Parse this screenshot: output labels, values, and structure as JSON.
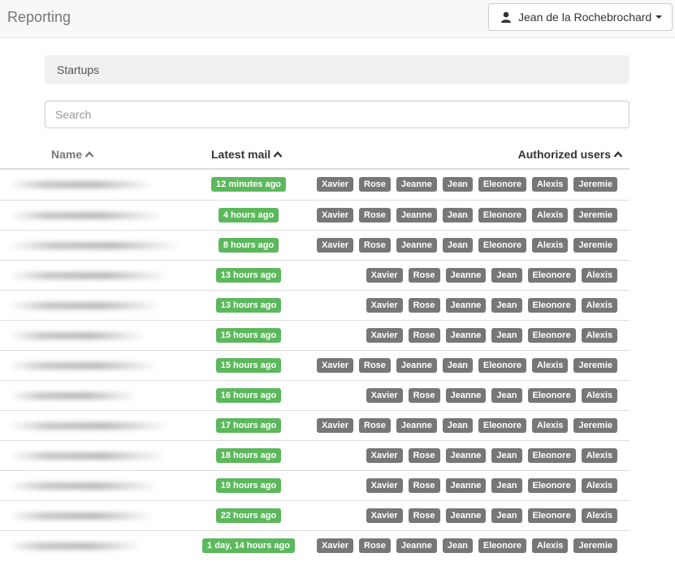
{
  "header": {
    "brand": "Reporting",
    "user_name": "Jean de la Rochebrochard"
  },
  "breadcrumb": {
    "label": "Startups"
  },
  "search": {
    "placeholder": "Search"
  },
  "table": {
    "columns": [
      "Name",
      "Latest mail",
      "Authorized users"
    ],
    "rows": [
      {
        "latest": "12 minutes ago",
        "users": [
          "Xavier",
          "Rose",
          "Jeanne",
          "Jean",
          "Eleonore",
          "Alexis",
          "Jeremie"
        ]
      },
      {
        "latest": "4 hours ago",
        "users": [
          "Xavier",
          "Rose",
          "Jeanne",
          "Jean",
          "Eleonore",
          "Alexis",
          "Jeremie"
        ]
      },
      {
        "latest": "8 hours ago",
        "users": [
          "Xavier",
          "Rose",
          "Jeanne",
          "Jean",
          "Eleonore",
          "Alexis",
          "Jeremie"
        ]
      },
      {
        "latest": "13 hours ago",
        "users": [
          "Xavier",
          "Rose",
          "Jeanne",
          "Jean",
          "Eleonore",
          "Alexis"
        ]
      },
      {
        "latest": "13 hours ago",
        "users": [
          "Xavier",
          "Rose",
          "Jeanne",
          "Jean",
          "Eleonore",
          "Alexis"
        ]
      },
      {
        "latest": "15 hours ago",
        "users": [
          "Xavier",
          "Rose",
          "Jeanne",
          "Jean",
          "Eleonore",
          "Alexis"
        ]
      },
      {
        "latest": "15 hours ago",
        "users": [
          "Xavier",
          "Rose",
          "Jeanne",
          "Jean",
          "Eleonore",
          "Alexis",
          "Jeremie"
        ]
      },
      {
        "latest": "16 hours ago",
        "users": [
          "Xavier",
          "Rose",
          "Jeanne",
          "Jean",
          "Eleonore",
          "Alexis"
        ]
      },
      {
        "latest": "17 hours ago",
        "users": [
          "Xavier",
          "Rose",
          "Jeanne",
          "Jean",
          "Eleonore",
          "Alexis",
          "Jeremie"
        ]
      },
      {
        "latest": "18 hours ago",
        "users": [
          "Xavier",
          "Rose",
          "Jeanne",
          "Jean",
          "Eleonore",
          "Alexis"
        ]
      },
      {
        "latest": "19 hours ago",
        "users": [
          "Xavier",
          "Rose",
          "Jeanne",
          "Jean",
          "Eleonore",
          "Alexis"
        ]
      },
      {
        "latest": "22 hours ago",
        "users": [
          "Xavier",
          "Rose",
          "Jeanne",
          "Jean",
          "Eleonore",
          "Alexis"
        ]
      },
      {
        "latest": "1 day, 14 hours ago",
        "users": [
          "Xavier",
          "Rose",
          "Jeanne",
          "Jean",
          "Eleonore",
          "Alexis",
          "Jeremie"
        ]
      }
    ]
  },
  "colors": {
    "success": "#5cb85c",
    "label_default": "#777777",
    "navbar_bg": "#f8f8f8"
  },
  "icons": {
    "user": "user-icon",
    "caret": "caret-down-icon",
    "sort": "chevron-up-icon"
  }
}
